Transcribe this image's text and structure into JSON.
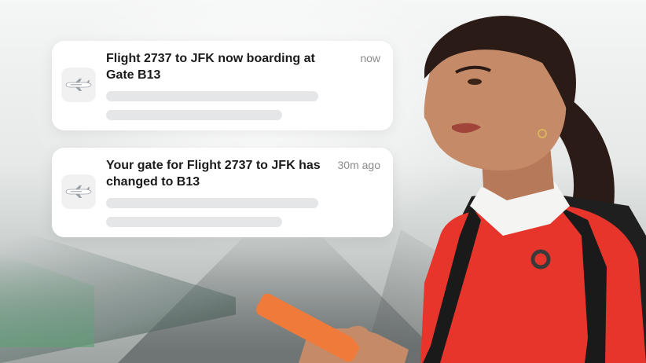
{
  "notifications": [
    {
      "icon": "airplane-icon",
      "title": "Flight 2737 to JFK now boarding at Gate B13",
      "time": "now"
    },
    {
      "icon": "airplane-icon",
      "title": "Your gate for Flight 2737 to JFK has changed to B13",
      "time": "30m ago"
    }
  ],
  "colors": {
    "card_background": "#ffffff",
    "placeholder": "#e4e6e8",
    "sweater": "#e8352c",
    "phone": "#f07a3a"
  }
}
